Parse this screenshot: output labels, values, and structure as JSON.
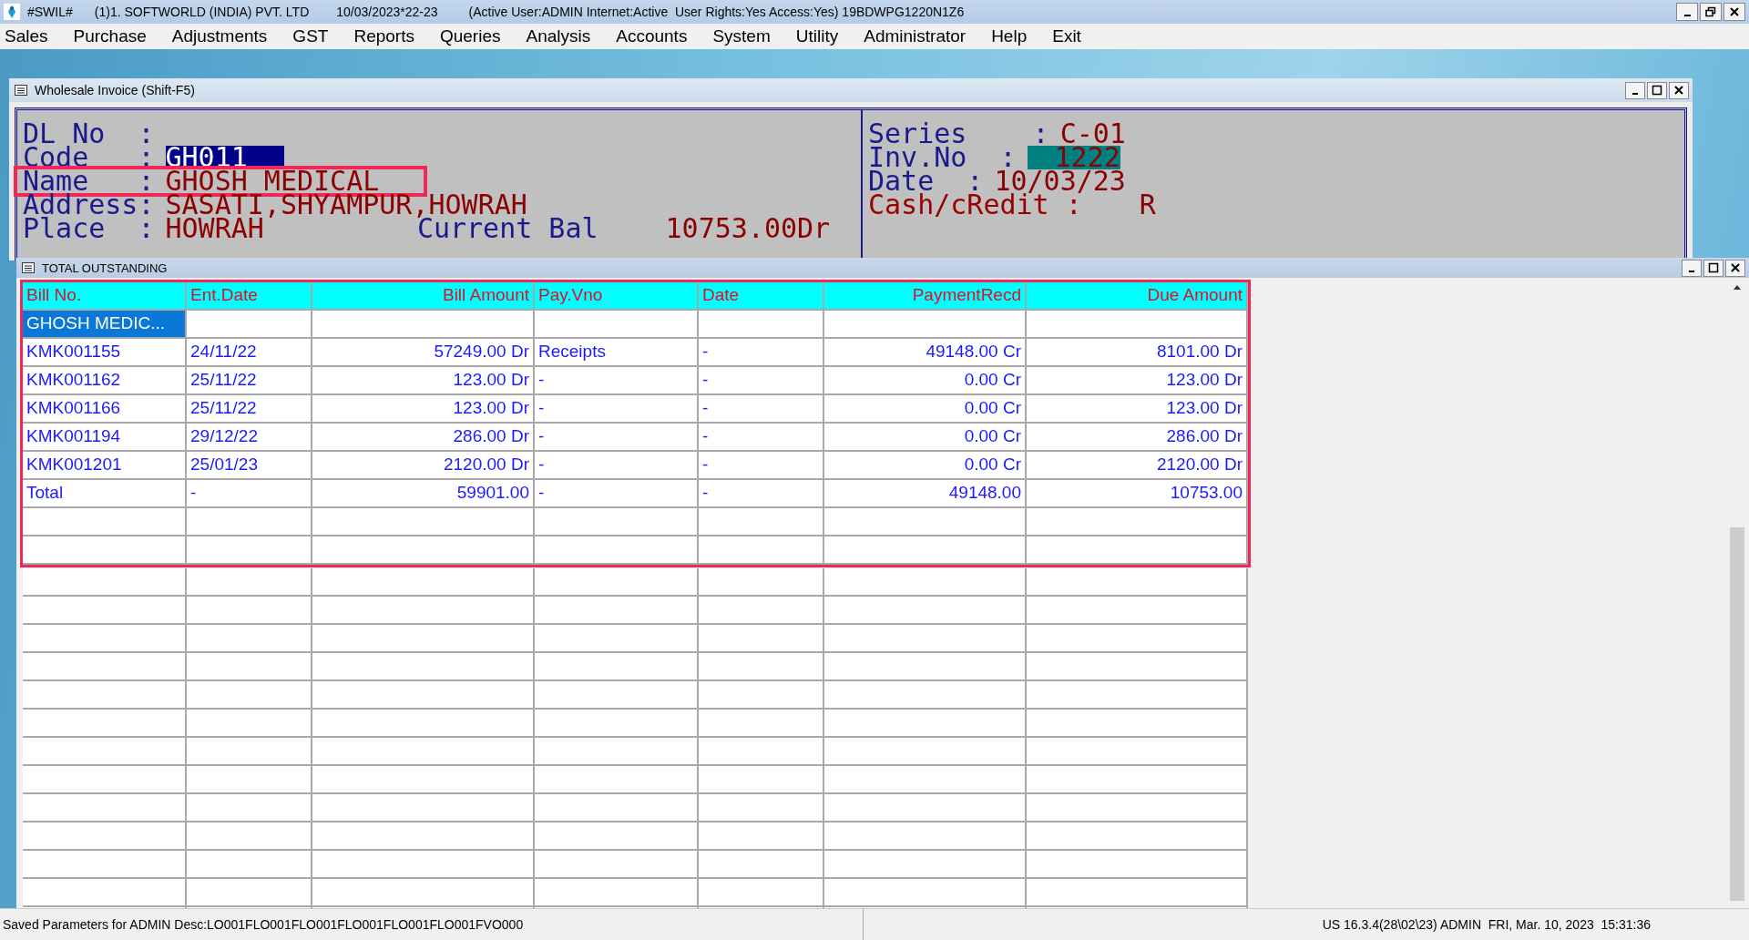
{
  "title_bar": {
    "app_name": "#SWIL#",
    "company": "(1)1. SOFTWORLD (INDIA) PVT. LTD",
    "session": "10/03/2023*22-23",
    "status": "(Active User:ADMIN Internet:Active  User Rights:Yes Access:Yes) 19BDWPG1220N1Z6"
  },
  "menu": [
    "Sales",
    "Purchase",
    "Adjustments",
    "GST",
    "Reports",
    "Queries",
    "Analysis",
    "Accounts",
    "System",
    "Utility",
    "Administrator",
    "Help",
    "Exit"
  ],
  "invoice_window": {
    "title": "Wholesale Invoice (Shift-F5)",
    "left_fields": [
      {
        "label": "DL No  :"
      },
      {
        "label": "Code   :",
        "value": "GH011",
        "selected": true
      },
      {
        "label": "Name   :",
        "value": "GHOSH MEDICAL",
        "selected": false,
        "marked": true
      },
      {
        "label": "Address:",
        "value": "SASATI,SHYAMPUR,HOWRAH",
        "selected": false
      },
      {
        "label": "Place  :",
        "value": "HOWRAH",
        "selected": false,
        "extra_label": "Current Bal",
        "extra_value": "10753.00Dr"
      }
    ],
    "right_fields": [
      {
        "kind": "field",
        "label": "Series    :",
        "value": "C-01",
        "selected": false
      },
      {
        "kind": "field",
        "label": "Inv.No  :",
        "value": "1222",
        "selected": true
      },
      {
        "kind": "field",
        "label": "Date  :",
        "value": "10/03/23",
        "selected": false
      },
      {
        "kind": "mode",
        "label": "Cash/cRedit :",
        "value": "R",
        "selected": false
      }
    ]
  },
  "outstanding_window": {
    "title": "TOTAL OUTSTANDING",
    "marked": true,
    "columns": [
      {
        "label": "Bill No.",
        "numeric": false
      },
      {
        "label": "Ent.Date",
        "numeric": false
      },
      {
        "label": "Bill Amount",
        "numeric": true
      },
      {
        "label": "Pay.Vno",
        "numeric": false
      },
      {
        "label": "Date",
        "numeric": false
      },
      {
        "label": "PaymentRecd",
        "numeric": true
      },
      {
        "label": "Due Amount",
        "numeric": true
      }
    ],
    "rows": [
      {
        "selected": true,
        "cells": [
          "GHOSH MEDIC...",
          "",
          "",
          "",
          "",
          "",
          ""
        ]
      },
      {
        "selected": false,
        "cells": [
          "KMK001155",
          "24/11/22",
          "57249.00 Dr",
          "Receipts",
          "-",
          "49148.00 Cr",
          "8101.00 Dr"
        ]
      },
      {
        "selected": false,
        "cells": [
          "KMK001162",
          "25/11/22",
          "123.00 Dr",
          "-",
          "-",
          "0.00 Cr",
          "123.00 Dr"
        ]
      },
      {
        "selected": false,
        "cells": [
          "KMK001166",
          "25/11/22",
          "123.00 Dr",
          "-",
          "-",
          "0.00 Cr",
          "123.00 Dr"
        ]
      },
      {
        "selected": false,
        "cells": [
          "KMK001194",
          "29/12/22",
          "286.00 Dr",
          "-",
          "-",
          "0.00 Cr",
          "286.00 Dr"
        ]
      },
      {
        "selected": false,
        "cells": [
          "KMK001201",
          "25/01/23",
          "2120.00 Dr",
          "-",
          "-",
          "0.00 Cr",
          "2120.00 Dr"
        ]
      },
      {
        "selected": false,
        "cells": [
          "Total",
          "-",
          "59901.00",
          "-",
          "-",
          "49148.00",
          "10753.00"
        ]
      }
    ]
  },
  "status_bar": {
    "left": "Saved Parameters for ADMIN Desc:LO001FLO001FLO001FLO001FLO001FLO001FVO000",
    "right": "US 16.3.4(28\\02\\23) ADMIN  FRI, Mar. 10, 2023  15:31:36"
  }
}
